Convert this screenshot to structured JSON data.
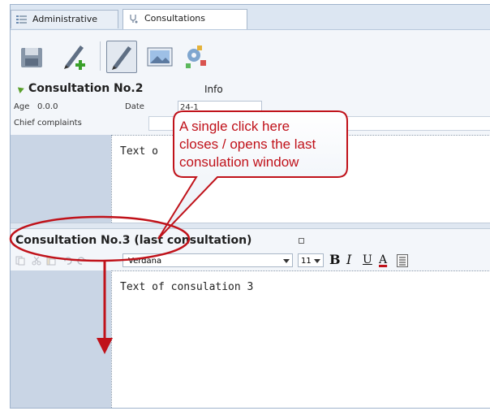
{
  "tabs": [
    {
      "label": "Administrative",
      "icon": "list-icon",
      "active": false
    },
    {
      "label": "Consultations",
      "icon": "stethoscope-icon",
      "active": true
    }
  ],
  "toolbar": {
    "buttons": [
      {
        "icon": "save-icon",
        "pressed": false
      },
      {
        "icon": "new-consultation-icon",
        "pressed": false
      },
      {
        "icon": "edit-icon",
        "pressed": true
      },
      {
        "icon": "image-viewer-icon",
        "pressed": false
      },
      {
        "icon": "tools-icon",
        "pressed": false
      }
    ]
  },
  "consultation2": {
    "title": "Consultation No.2",
    "info_label": "Info",
    "age_label": "Age",
    "age_value": "0.0.0",
    "date_label": "Date",
    "date_value": "24-1",
    "chief_complaints_label": "Chief complaints",
    "text": "Text o"
  },
  "consultation3": {
    "title": "Consultation No.3 (last consultation)",
    "font": "Verdana",
    "font_size": "11",
    "format_buttons": [
      "B",
      "I",
      "U",
      "A"
    ],
    "text": "Text of consulation 3"
  },
  "annotation": {
    "lines": [
      "A single click here",
      "closes / opens the last",
      "consulation window"
    ],
    "color": "#c0121a"
  },
  "colors": {
    "tab_bar": "#dce6f2",
    "side_column": "#c9d5e5",
    "title_arrow": "#5aa02c"
  }
}
